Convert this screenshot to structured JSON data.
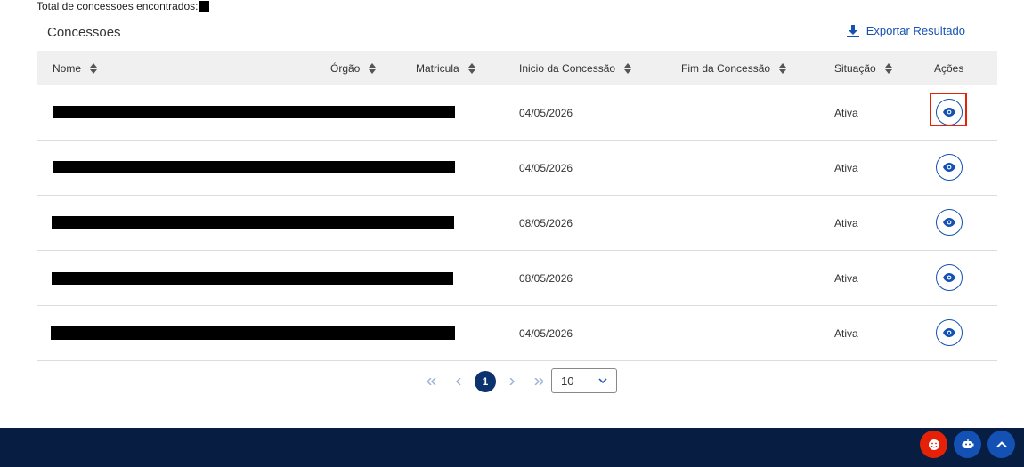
{
  "header": {
    "total_label": "Total de concessoes encontrados:",
    "section_title": "Concessoes",
    "export_label": "Exportar Resultado"
  },
  "table": {
    "columns": [
      "Nome",
      "Órgão",
      "Matricula",
      "Inicio da Concessão",
      "Fim da Concessão",
      "Situação",
      "Ações"
    ],
    "rows": [
      {
        "inicio": "04/05/2026",
        "situacao": "Ativa"
      },
      {
        "inicio": "04/05/2026",
        "situacao": "Ativa"
      },
      {
        "inicio": "08/05/2026",
        "situacao": "Ativa"
      },
      {
        "inicio": "08/05/2026",
        "situacao": "Ativa"
      },
      {
        "inicio": "04/05/2026",
        "situacao": "Ativa"
      }
    ]
  },
  "pagination": {
    "first_icon": "double-chevron-left-icon",
    "prev_icon": "chevron-left-icon",
    "current_page": "1",
    "next_icon": "chevron-right-icon",
    "last_icon": "double-chevron-right-icon",
    "page_size": "10"
  },
  "floating_buttons": [
    {
      "icon": "smiley-icon",
      "color": "#e52207"
    },
    {
      "icon": "robot-icon",
      "color": "#1351b4"
    },
    {
      "icon": "chevron-up-icon",
      "color": "#1351b4"
    }
  ],
  "colors": {
    "primary": "#1351b4",
    "footer": "#071d41",
    "highlight": "#e52207",
    "pagination_current": "#0c326f"
  }
}
